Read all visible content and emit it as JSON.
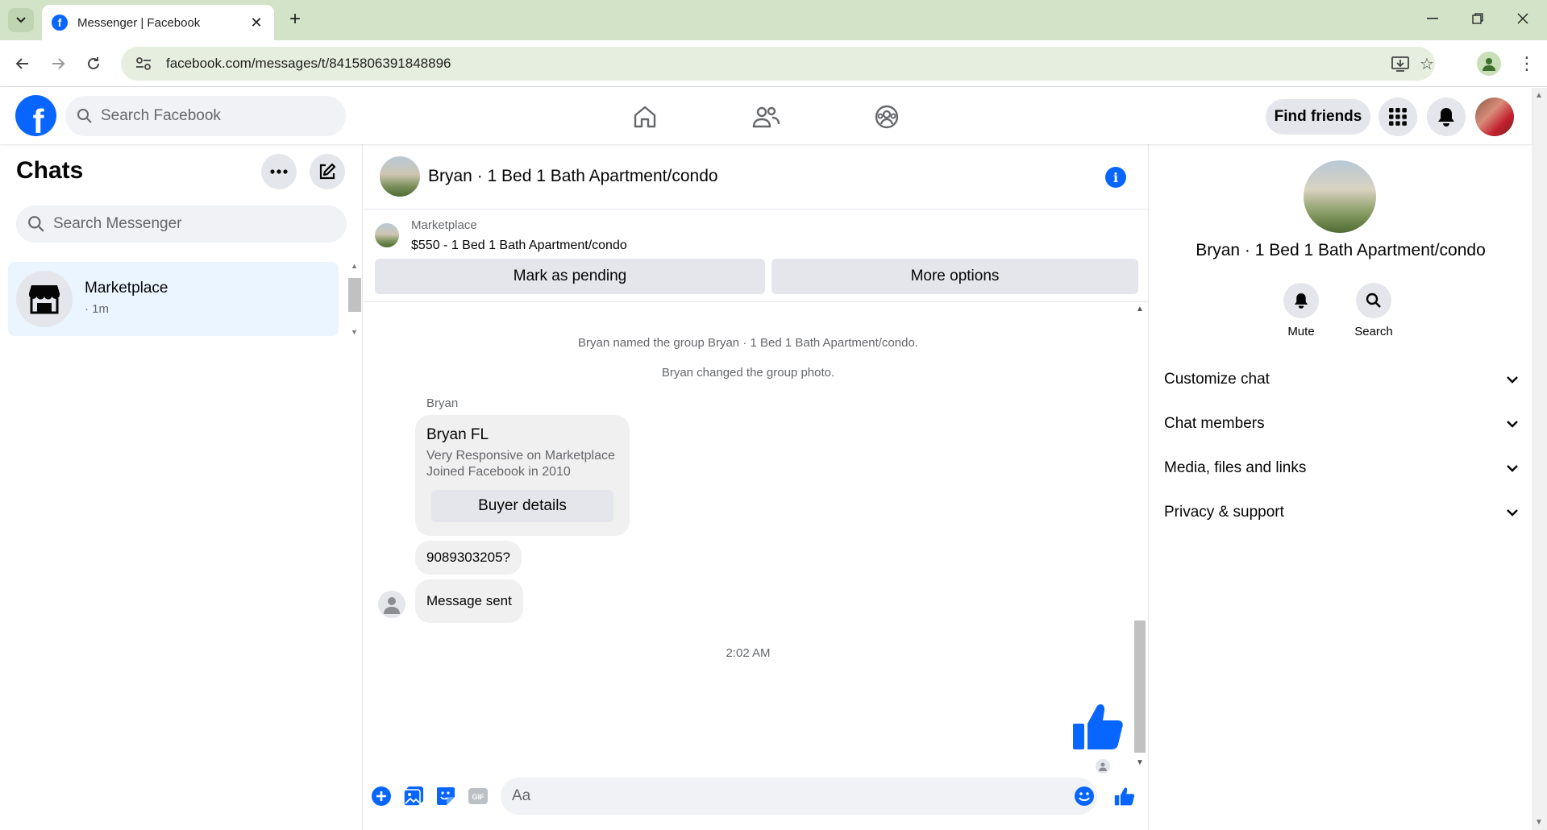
{
  "browser": {
    "tab_title": "Messenger | Facebook",
    "url": "facebook.com/messages/t/8415806391848896"
  },
  "header": {
    "search_placeholder": "Search Facebook",
    "find_friends": "Find friends"
  },
  "chats": {
    "title": "Chats",
    "search_placeholder": "Search Messenger",
    "items": [
      {
        "name": "Marketplace",
        "time": "· 1m"
      }
    ]
  },
  "conversation": {
    "title": "Bryan · 1 Bed 1 Bath Apartment/condo",
    "marketplace": {
      "label": "Marketplace",
      "listing": "$550 - 1 Bed 1 Bath Apartment/condo",
      "mark_pending": "Mark as pending",
      "more_options": "More options"
    },
    "system_messages": [
      "Bryan named the group Bryan · 1 Bed 1 Bath Apartment/condo.",
      "Bryan changed the group photo."
    ],
    "sender": "Bryan",
    "card": {
      "title": "Bryan FL",
      "line1": "Very Responsive on Marketplace",
      "line2": "Joined Facebook in 2010",
      "button": "Buyer details"
    },
    "bubbles": [
      "9089303205?",
      "Message sent"
    ],
    "timestamp": "2:02 AM",
    "composer_placeholder": "Aa"
  },
  "info_panel": {
    "name": "Bryan · 1 Bed 1 Bath Apartment/condo",
    "actions": [
      "Mute",
      "Search"
    ],
    "sections": [
      "Customize chat",
      "Chat members",
      "Media, files and links",
      "Privacy & support"
    ]
  },
  "colors": {
    "brand": "#0866ff",
    "tabbar": "#d3e3c7",
    "selected_chat": "#ebf5ff"
  }
}
